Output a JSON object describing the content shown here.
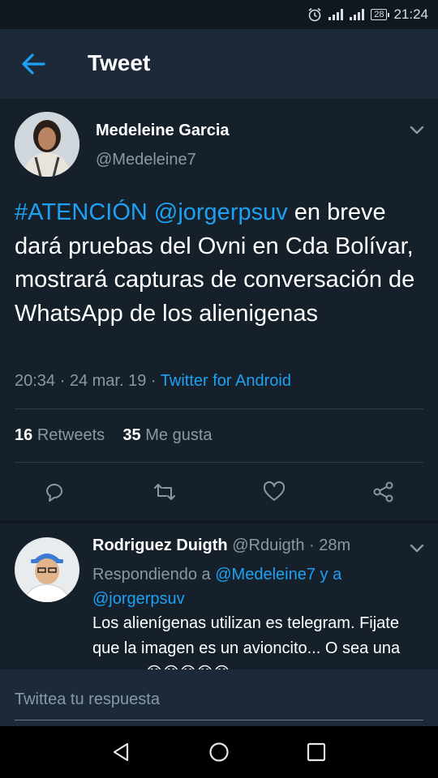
{
  "status_bar": {
    "battery": "28",
    "time": "21:24",
    "icons": [
      "alarm-icon",
      "signal-icon",
      "battery-icon"
    ]
  },
  "app_bar": {
    "title": "Tweet",
    "back_icon": "arrow-left-icon"
  },
  "tweet": {
    "author_name": "Medeleine Garcia",
    "author_handle": "@Medeleine7",
    "text": {
      "hashtag": "#ATENCIÓN",
      "mention": "@jorgerpsuv",
      "body": " en breve dará pruebas del Ovni en Cda Bolívar, mostrará capturas de conversación de WhatsApp de los alienigenas"
    },
    "time": "20:34",
    "date": "24 mar. 19",
    "separator": " · ",
    "source": "Twitter for Android",
    "retweets_count": "16",
    "retweets_label": "Retweets",
    "likes_count": "35",
    "likes_label": "Me gusta",
    "actions": [
      "reply-icon",
      "retweet-icon",
      "like-icon",
      "share-icon"
    ]
  },
  "reply": {
    "name": "Rodriguez Duigth",
    "handle": "@Rduigth",
    "age": "28m",
    "replying_prefix": "Respondiendo a ",
    "replying_to_1": "@Medeleine7",
    "replying_join": " y a ",
    "replying_to_2": "@jorgerpsuv",
    "text": "Los alienígenas utilizan es telegram. Fijate que la imagen es un avioncito... O sea una nave... ",
    "emoji": "😁😁😁😁😁"
  },
  "composer": {
    "placeholder": "Twittea tu respuesta"
  },
  "nav": [
    "back-triangle-icon",
    "home-circle-icon",
    "recents-square-icon"
  ],
  "colors": {
    "background": "#15202b",
    "header": "#1c2938",
    "accent": "#1da1f2",
    "secondary_text": "#8899a6"
  }
}
